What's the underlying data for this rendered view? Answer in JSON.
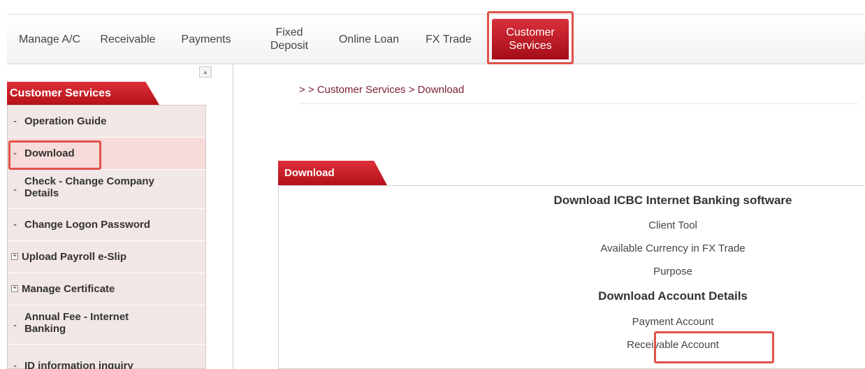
{
  "topnav": {
    "items": [
      {
        "label": "Manage A/C"
      },
      {
        "label": "Receivable"
      },
      {
        "label": "Payments"
      },
      {
        "line1": "Fixed",
        "line2": "Deposit"
      },
      {
        "label": "Online Loan"
      },
      {
        "label": "FX Trade"
      },
      {
        "line1": "Customer",
        "line2": "Services"
      }
    ]
  },
  "sidebar": {
    "header": "Customer Services",
    "collapse_icon": "▲",
    "items": [
      {
        "prefix": "-",
        "label": "Operation Guide"
      },
      {
        "prefix": "-",
        "label": "Download"
      },
      {
        "prefix": "-",
        "line1": "Check - Change Company",
        "line2": "Details"
      },
      {
        "prefix": "-",
        "label": "Change Logon Password"
      },
      {
        "prefix": "+",
        "label": "Upload Payroll e-Slip"
      },
      {
        "prefix": "+",
        "label": "Manage Certificate"
      },
      {
        "prefix": "-",
        "line1": "Annual Fee - Internet",
        "line2": "Banking"
      },
      {
        "prefix": "-",
        "label": "ID information inquiry"
      }
    ]
  },
  "breadcrumb": "> > Customer Services > Download",
  "panel": {
    "tab": "Download",
    "software_heading": "Download ICBC Internet Banking software",
    "software_links": [
      "Client Tool",
      "Available Currency in FX Trade",
      "Purpose"
    ],
    "account_heading": "Download Account Details",
    "account_links": [
      "Payment Account",
      "Receivable Account"
    ]
  },
  "colors": {
    "brand_red": "#c41a24",
    "highlight_box": "#e0524a"
  }
}
